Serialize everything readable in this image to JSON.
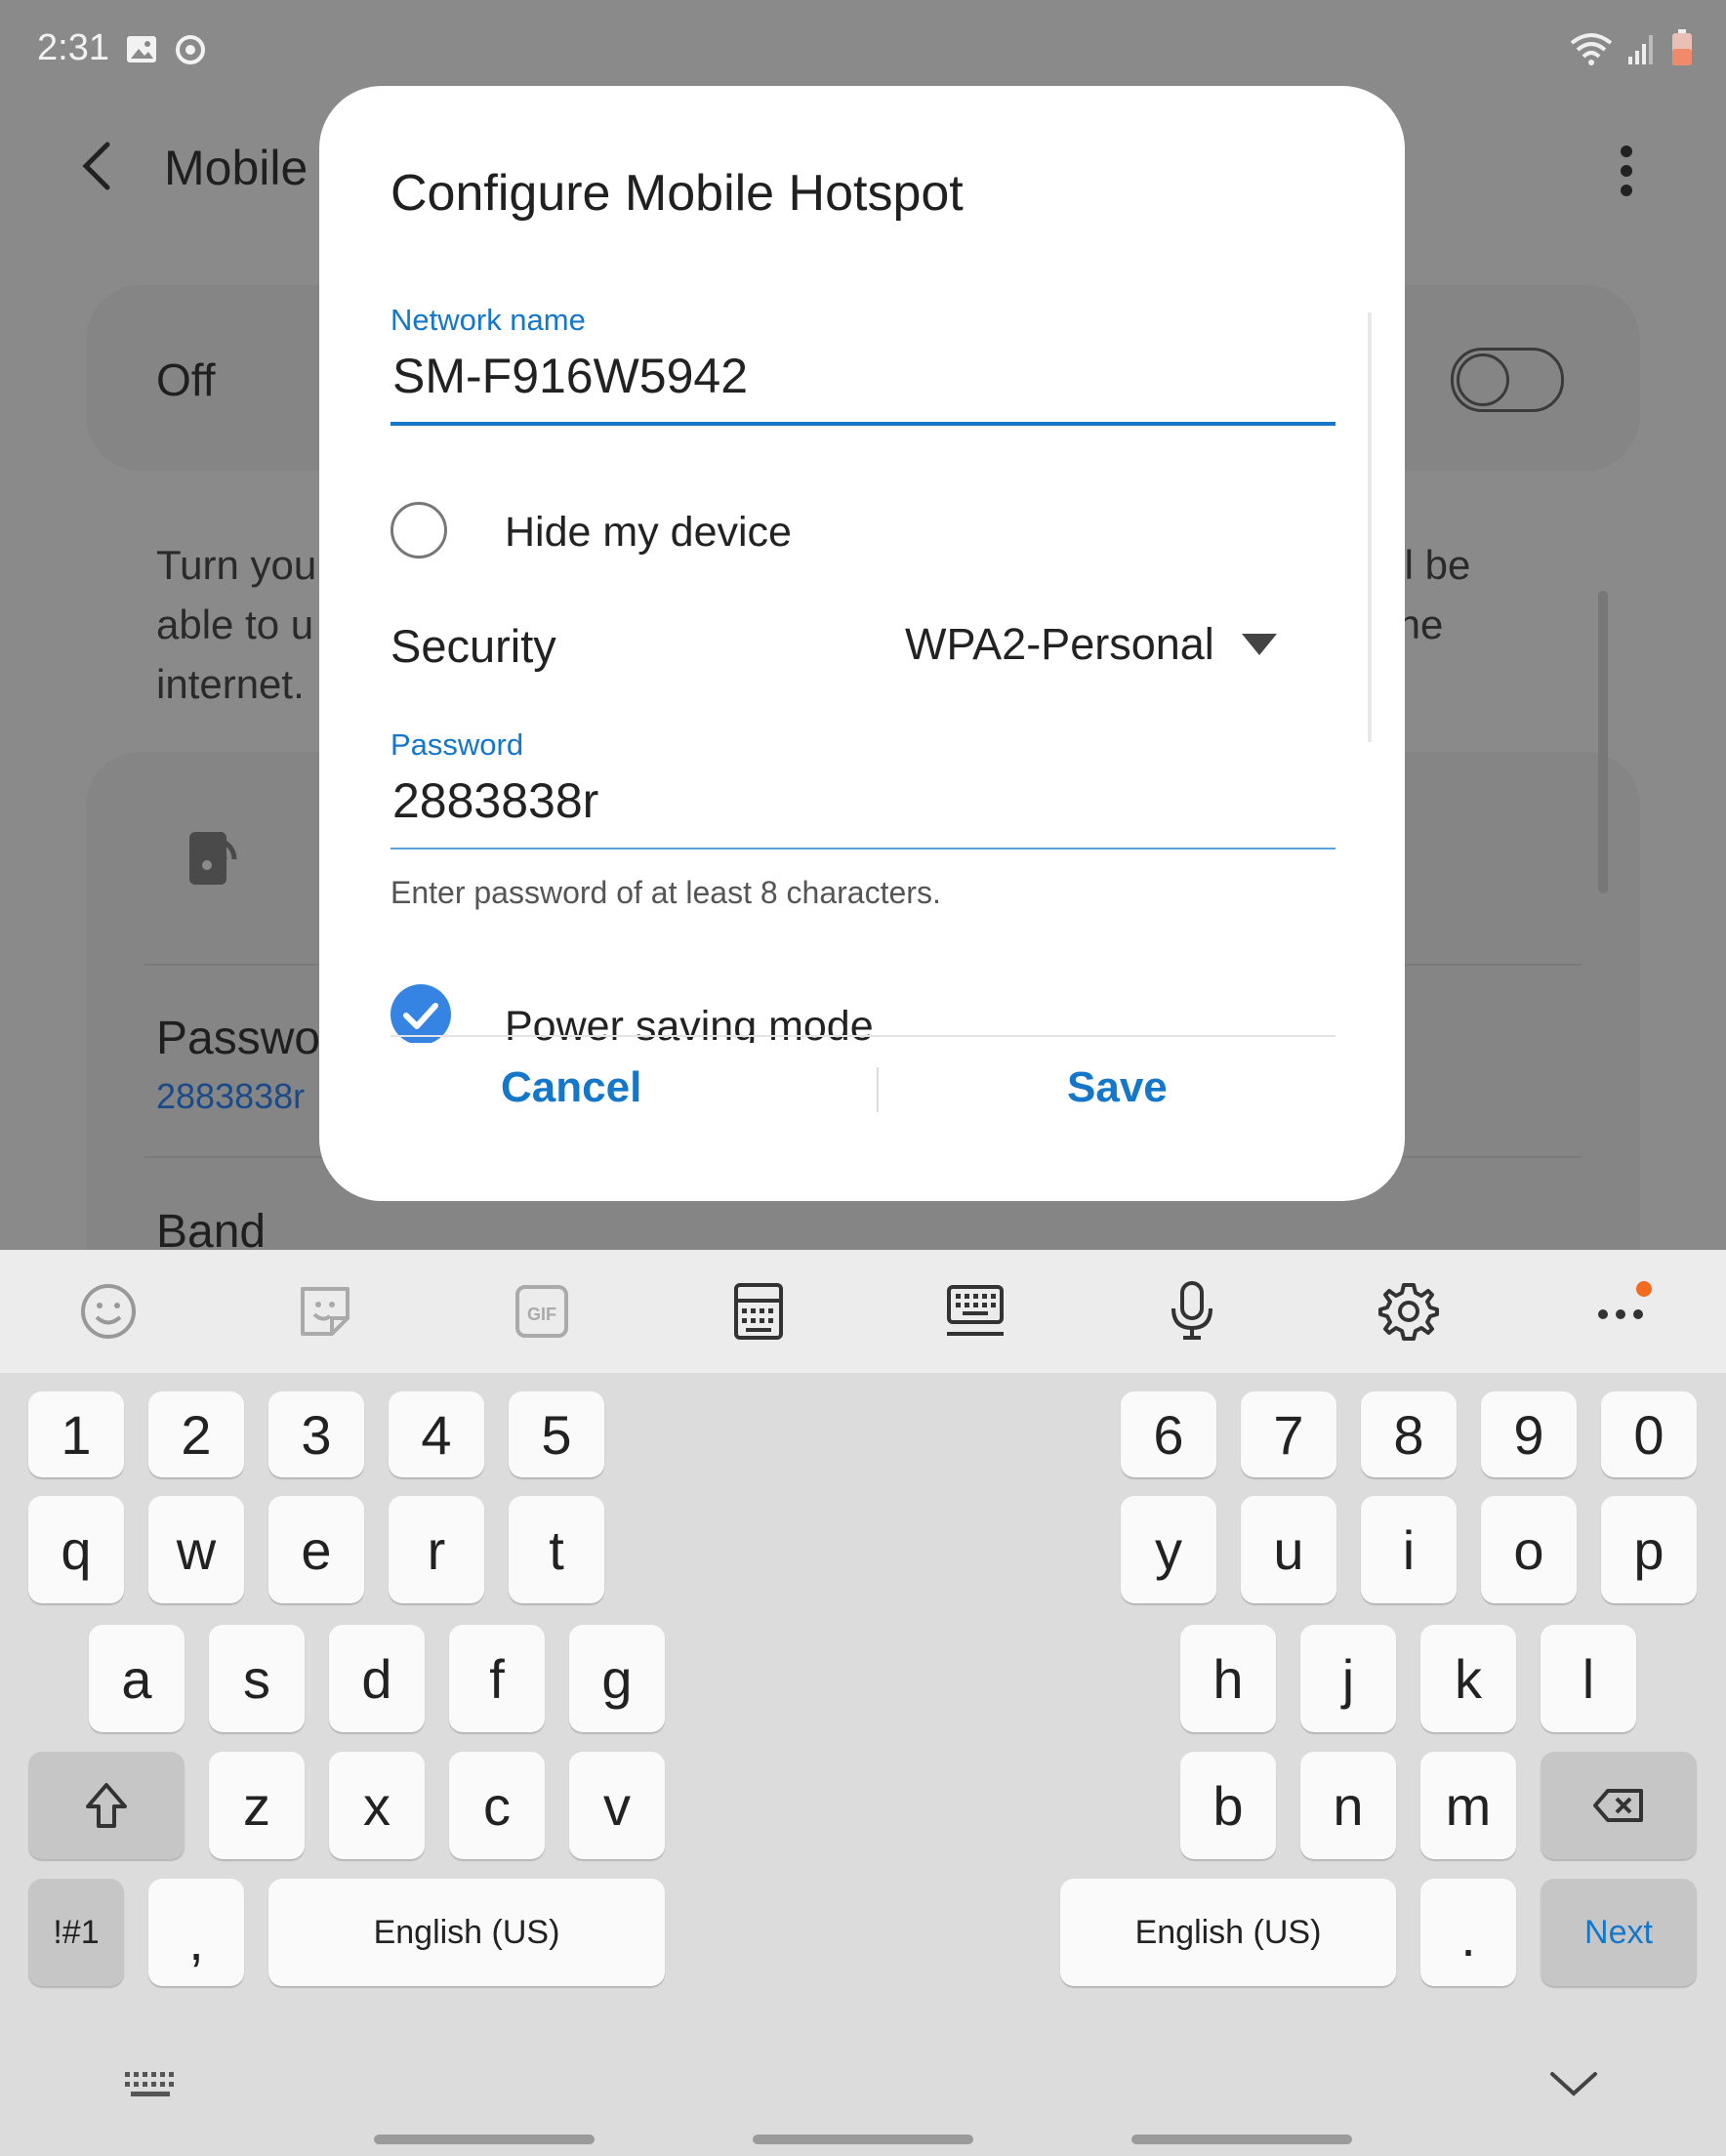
{
  "status_bar": {
    "time": "2:31",
    "left_icons": [
      "image-icon",
      "sync-icon"
    ],
    "right_icons": [
      "wifi-icon",
      "signal-icon",
      "battery-icon"
    ]
  },
  "background_screen": {
    "title": "Mobile",
    "off_label": "Off",
    "description_left": [
      "Turn you",
      "able to u",
      "internet."
    ],
    "description_right": [
      "ill be",
      "the"
    ],
    "password_label": "Passwo",
    "password_value": "2883838r",
    "band_label": "Band"
  },
  "dialog": {
    "title": "Configure Mobile Hotspot",
    "network_name_label": "Network name",
    "network_name_value": "SM-F916W5942",
    "hide_device_label": "Hide my device",
    "hide_device_checked": false,
    "security_label": "Security",
    "security_value": "WPA2-Personal",
    "password_label": "Password",
    "password_value": "2883838r",
    "password_hint": "Enter password of at least 8 characters.",
    "power_saving_label": "Power saving mode",
    "power_saving_checked": true,
    "cancel_label": "Cancel",
    "save_label": "Save"
  },
  "keyboard": {
    "toolbar_icons": [
      "emoji-icon",
      "sticker-icon",
      "gif-icon",
      "keyboard-mode-icon",
      "keyboard-layout-icon",
      "microphone-icon",
      "settings-icon",
      "more-icon"
    ],
    "left": {
      "row_numbers": [
        "1",
        "2",
        "3",
        "4",
        "5"
      ],
      "row_top": [
        "q",
        "w",
        "e",
        "r",
        "t"
      ],
      "row_home": [
        "a",
        "s",
        "d",
        "f",
        "g"
      ],
      "row_bottom": [
        "z",
        "x",
        "c",
        "v"
      ],
      "symbols_label": "!#1",
      "comma": ",",
      "space_label": "English (US)"
    },
    "right": {
      "row_numbers": [
        "6",
        "7",
        "8",
        "9",
        "0"
      ],
      "row_top": [
        "y",
        "u",
        "i",
        "o",
        "p"
      ],
      "row_home": [
        "h",
        "j",
        "k",
        "l"
      ],
      "row_bottom": [
        "b",
        "n",
        "m"
      ],
      "space_label": "English (US)",
      "period": ".",
      "next_label": "Next"
    }
  },
  "colors": {
    "accent": "#1477c9",
    "check_fill": "#3584e4",
    "scrim": "#8b8b8b",
    "keyboard_bg": "#dcdcdc"
  }
}
